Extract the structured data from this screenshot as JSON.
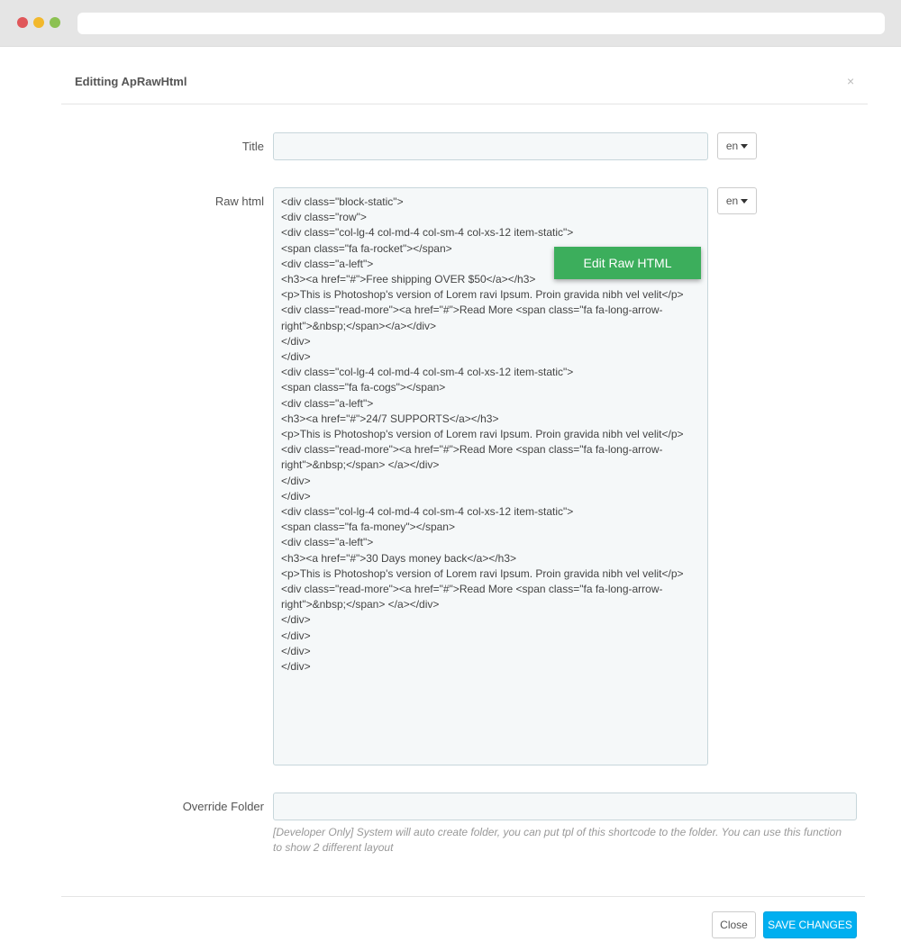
{
  "modal": {
    "title": "Editting ApRawHtml",
    "close_symbol": "×"
  },
  "form": {
    "title_label": "Title",
    "title_value": "",
    "title_lang": "en",
    "raw_label": "Raw html",
    "raw_lang": "en",
    "raw_lines": [
      "<div class=\"block-static\">",
      "<div class=\"row\">",
      "<div class=\"col-lg-4 col-md-4 col-sm-4 col-xs-12 item-static\">",
      "<span class=\"fa fa-rocket\"></span>",
      "<div class=\"a-left\">",
      "<h3><a href=\"#\">Free shipping OVER $50</a></h3>",
      "<p>This is Photoshop's version of Lorem ravi Ipsum. Proin gravida nibh vel velit</p>",
      "<div class=\"read-more\"><a href=\"#\">Read More <span class=\"fa fa-long-arrow-right\">&nbsp;</span></a></div>",
      "</div>",
      "</div>",
      "<div class=\"col-lg-4 col-md-4 col-sm-4 col-xs-12 item-static\">",
      "<span class=\"fa fa-cogs\"></span>",
      "<div class=\"a-left\">",
      "<h3><a href=\"#\">24/7 SUPPORTS</a></h3>",
      "<p>This is Photoshop's version of Lorem ravi Ipsum. Proin gravida nibh vel velit</p>",
      "<div class=\"read-more\"><a href=\"#\">Read More <span class=\"fa fa-long-arrow-right\">&nbsp;</span> </a></div>",
      "</div>",
      "</div>",
      "<div class=\"col-lg-4 col-md-4 col-sm-4 col-xs-12 item-static\">",
      "<span class=\"fa fa-money\"></span>",
      "<div class=\"a-left\">",
      "<h3><a href=\"#\">30 Days money back</a></h3>",
      "<p>This is Photoshop's version of Lorem ravi Ipsum. Proin gravida nibh vel velit</p>",
      "<div class=\"read-more\"><a href=\"#\">Read More <span class=\"fa fa-long-arrow-right\">&nbsp;</span> </a></div>",
      "</div>",
      "</div>",
      "</div>",
      "</div>"
    ],
    "edit_raw_button": "Edit Raw HTML",
    "override_label": "Override Folder",
    "override_value": "",
    "override_help": "[Developer Only] System will auto create folder, you can put tpl of this shortcode to the folder. You can use this function to show 2 different layout"
  },
  "footer": {
    "close_label": "Close",
    "save_label": "SAVE CHANGES"
  },
  "colors": {
    "save_button": "#00aff0",
    "edit_raw_button": "#3cae5c"
  }
}
